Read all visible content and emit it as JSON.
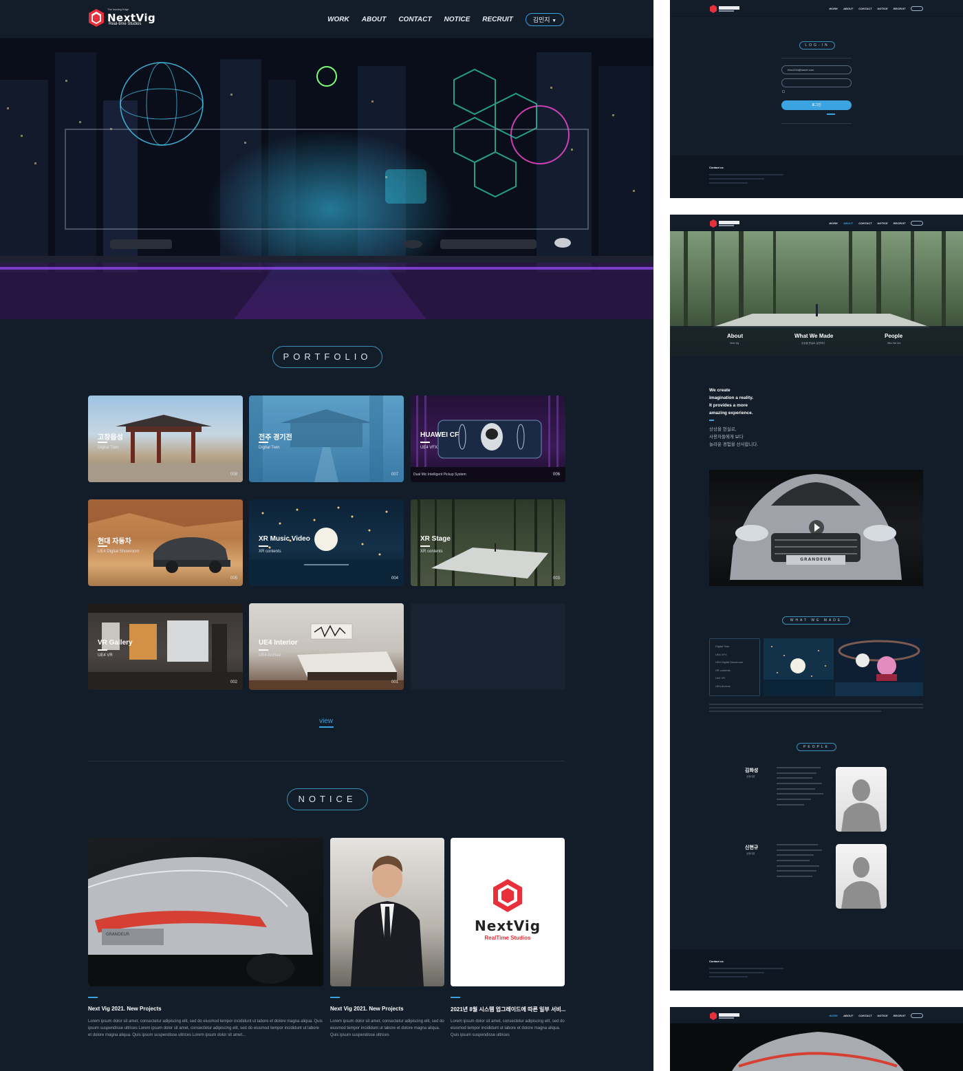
{
  "brand": {
    "name": "NextVig",
    "tagline": "The leading Edge",
    "subtitle": "Real-time Studios",
    "notice_logo_name": "NextVig",
    "notice_logo_sub": "RealTime Studios"
  },
  "nav": {
    "items": [
      "WORK",
      "ABOUT",
      "CONTACT",
      "NOTICE",
      "RECRUIT"
    ],
    "user": "김민지"
  },
  "colors": {
    "accent": "#3aa3e0",
    "background": "#131c29",
    "brand_red": "#e8303a"
  },
  "portfolio": {
    "heading": "PORTFOLIO",
    "items": [
      {
        "title": "고창읍성",
        "subtitle": "Digital Twin",
        "number": "008",
        "caption": ""
      },
      {
        "title": "전주 경기전",
        "subtitle": "Digital Twin",
        "number": "007",
        "caption": ""
      },
      {
        "title": "HUAWEI CF",
        "subtitle": "UE4 VFX",
        "number": "006",
        "caption": "Dual Mic Intelligent Pickup System"
      },
      {
        "title": "현대 자동차",
        "subtitle": "UE4 Digital Showroom",
        "number": "005",
        "caption": ""
      },
      {
        "title": "XR Music Video",
        "subtitle": "XR contents",
        "number": "004",
        "caption": ""
      },
      {
        "title": "XR Stage",
        "subtitle": "XR contents",
        "number": "003",
        "caption": ""
      },
      {
        "title": "VR Gallery",
        "subtitle": "UE4 VR",
        "number": "002",
        "caption": ""
      },
      {
        "title": "UE4 Interior",
        "subtitle": "UE4 Archviz",
        "number": "001",
        "caption": ""
      }
    ],
    "view_label": "view"
  },
  "notice": {
    "heading": "NOTICE",
    "items": [
      {
        "title": "Next Vig 2021. New Projects",
        "body": "Lorem ipsum dolor sit amet, consectetur adipiscing elit, sed do eiusmod tempor incididunt ut labore et dolore magna aliqua. Quis ipsum suspendisse ultrices Lorem ipsum dolor sit amet, consectetur adipiscing elit, sed do eiusmod tempor incididunt ut labore et dolore magna aliqua. Quis ipsum suspendisse ultrices Lorem ipsum dolor sit amet..."
      },
      {
        "title": "Next Vig 2021. New Projects",
        "body": "Lorem ipsum dolor sit amet, consectetur adipiscing elit, sed do eiusmod tempor incididunt ut labore et dolore magna aliqua. Quis ipsum suspendisse ultrices"
      },
      {
        "title": "2021년 8월 시스템 업그레이드에 따른 일부 서비...",
        "body": "Lorem ipsum dolor sit amet, consectetur adipiscing elit, sed do eiusmod tempor incididunt ut labore et dolore magna aliqua. Quis ipsum suspendisse ultrices"
      }
    ],
    "car_badge": "GRANDEUR"
  },
  "login": {
    "heading": "LOG-IN",
    "email_value": "Kim1234@naver.com",
    "submit": "로그인"
  },
  "footer": {
    "heading": "Contact us"
  },
  "about": {
    "tabs": [
      {
        "label": "About",
        "sub": "Next Vig"
      },
      {
        "label": "What We Made",
        "sub": "상상을 현실로 실현하다"
      },
      {
        "label": "People",
        "sub": "Who We Are"
      }
    ],
    "slogan_en": [
      "We create",
      "imagination a reality.",
      "It provides a more",
      "amazing experience."
    ],
    "slogan_ko": [
      "상상을 현실로,",
      "사용자들에게 보다",
      "놀라운 경험을 선사합니다."
    ],
    "video_badge": "GRANDEUR",
    "made_heading": "WHAT WE MADE",
    "made_list": [
      "Digital Twin",
      "UE4 VFX",
      "UE4 Digital Showroom",
      "XR contents",
      "Ue4 VR",
      "UE4 Archviz"
    ],
    "people_heading": "PEOPLE",
    "people": [
      {
        "name": "김화성",
        "role": "공동대표"
      },
      {
        "name": "신현규",
        "role": "공동대표"
      }
    ]
  }
}
